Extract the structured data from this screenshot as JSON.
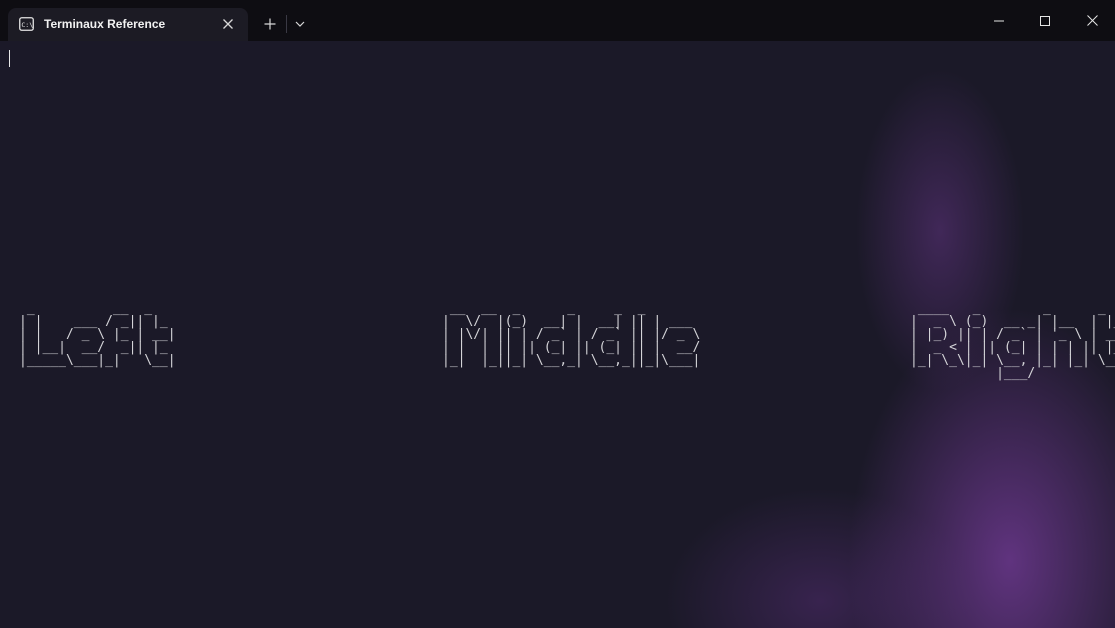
{
  "tab": {
    "title": "Terminaux Reference",
    "icon": "terminal-icon"
  },
  "controls": {
    "new_tab": "+",
    "close_tab": "close-icon",
    "dropdown": "chevron-down-icon",
    "minimize": "minimize-icon",
    "maximize": "maximize-icon",
    "close_window": "close-icon"
  },
  "terminal": {
    "ascii_left": " _          __  _   \n| |    ___ / _|| |_ \n| |   / _ \\ |_ | __|\n| |__|  __/  _|| |_ \n|_____\\___|_|   \\__|",
    "ascii_middle": " __  __  _      _     _  _       \n|  \\/  |(_)  __| |  __| || | ___ \n| |\\/| || | / _` | / _` || |/ _ \\\n| |  | || || (_| || (_| || |  __/\n|_|  |_||_| \\__,_| \\__,_||_|\\___|",
    "ascii_right": " ____   _        _      _   \n|  _ \\ (_)  __ _| |__  | |_ \n| |_) || | / _` | '_ \\ | __|\n|  _ < | || (_| | | | || |_ \n|_| \\_\\|_| \\__, |_| |_| \\__|\n           |___/            ",
    "colors": {
      "background": "#1b1928",
      "glow": "#6c388e",
      "text": "#d4d4d8"
    }
  }
}
